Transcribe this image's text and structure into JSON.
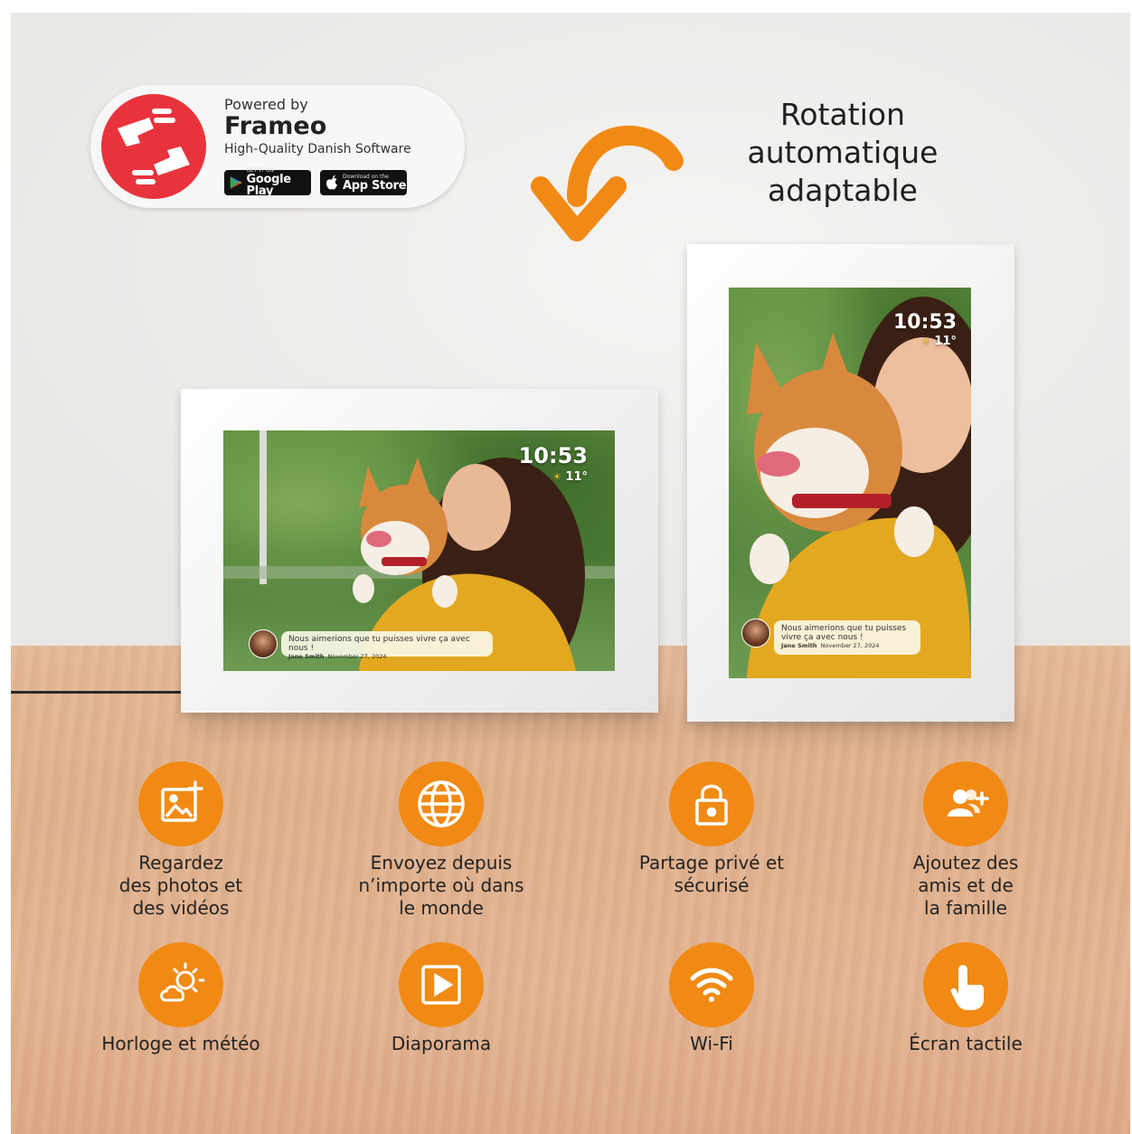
{
  "badge": {
    "powered_by": "Powered by",
    "brand": "Frameo",
    "tagline": "High-Quality Danish Software",
    "google_small": "GET IT ON",
    "google_big": "Google Play",
    "apple_small": "Download on the",
    "apple_big": "App Store"
  },
  "rotation": {
    "line1": "Rotation",
    "line2": "automatique",
    "line3": "adaptable"
  },
  "landscape_frame": {
    "time": "10:53",
    "temperature": "11°",
    "message": "Nous aimerions que tu puisses vivre ça avec nous !",
    "sender": "Jane Smith",
    "date": "November 27, 2024"
  },
  "portrait_frame": {
    "time": "10:53",
    "temperature": "11°",
    "message": "Nous aimerions que tu puisses vivre ça avec nous !",
    "sender": "Jane Smith",
    "date": "November 27, 2024"
  },
  "features": [
    {
      "icon": "photo-add-icon",
      "label": "Regardez\ndes photos et\ndes vidéos"
    },
    {
      "icon": "globe-icon",
      "label": "Envoyez depuis\nn’importe où dans\nle monde"
    },
    {
      "icon": "lock-icon",
      "label": "Partage privé et\nsécurisé"
    },
    {
      "icon": "add-user-icon",
      "label": "Ajoutez des\namis et de\nla famille"
    },
    {
      "icon": "weather-icon",
      "label": "Horloge et météo"
    },
    {
      "icon": "slideshow-icon",
      "label": "Diaporama"
    },
    {
      "icon": "wifi-icon",
      "label": "Wi-Fi"
    },
    {
      "icon": "touch-icon",
      "label": "Écran tactile"
    }
  ],
  "colors": {
    "accent": "#f18a14",
    "frameo_red": "#e8333c"
  }
}
